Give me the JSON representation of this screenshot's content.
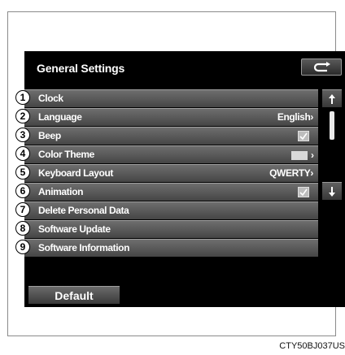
{
  "screen": {
    "title": "General Settings",
    "items": [
      {
        "num": "1",
        "label": "Clock",
        "value": "",
        "control": "none"
      },
      {
        "num": "2",
        "label": "Language",
        "value": "English",
        "control": "value-arrow"
      },
      {
        "num": "3",
        "label": "Beep",
        "value": "",
        "control": "checkbox",
        "checked": true
      },
      {
        "num": "4",
        "label": "Color Theme",
        "value": "",
        "control": "swatch-arrow"
      },
      {
        "num": "5",
        "label": "Keyboard Layout",
        "value": "QWERTY",
        "control": "value-arrow"
      },
      {
        "num": "6",
        "label": "Animation",
        "value": "",
        "control": "checkbox",
        "checked": true
      },
      {
        "num": "7",
        "label": "Delete Personal Data",
        "value": "",
        "control": "none"
      },
      {
        "num": "8",
        "label": "Software Update",
        "value": "",
        "control": "none"
      },
      {
        "num": "9",
        "label": "Software Information",
        "value": "",
        "control": "none"
      }
    ],
    "default_label": "Default",
    "back_icon": "back-arrow-icon",
    "scroll_up_icon": "scroll-up-icon",
    "scroll_down_icon": "scroll-down-icon"
  },
  "caption": "CTY50BJ037US",
  "colors": {
    "screen_bg": "#000000",
    "row_top": "#6e6e6e",
    "row_bottom": "#454545",
    "text": "#ffffff"
  }
}
